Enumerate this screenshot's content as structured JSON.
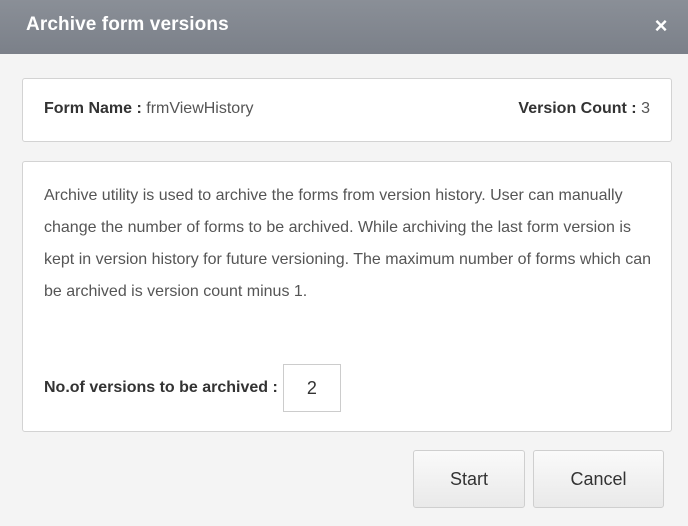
{
  "dialog": {
    "title": "Archive form versions",
    "close_icon": "×"
  },
  "info": {
    "form_name_label": "Form Name :",
    "form_name_value": "frmViewHistory",
    "version_count_label": "Version Count :",
    "version_count_value": "3"
  },
  "description": {
    "text": "Archive utility is used to archive the forms from version history. User can manually change the number of forms to be archived. While archiving the last form version is kept in version history for future versioning. The maximum number of forms which can be archived is version count minus 1."
  },
  "archive": {
    "label": "No.of versions to be archived :",
    "value": "2"
  },
  "buttons": {
    "start_label": "Start",
    "cancel_label": "Cancel"
  }
}
